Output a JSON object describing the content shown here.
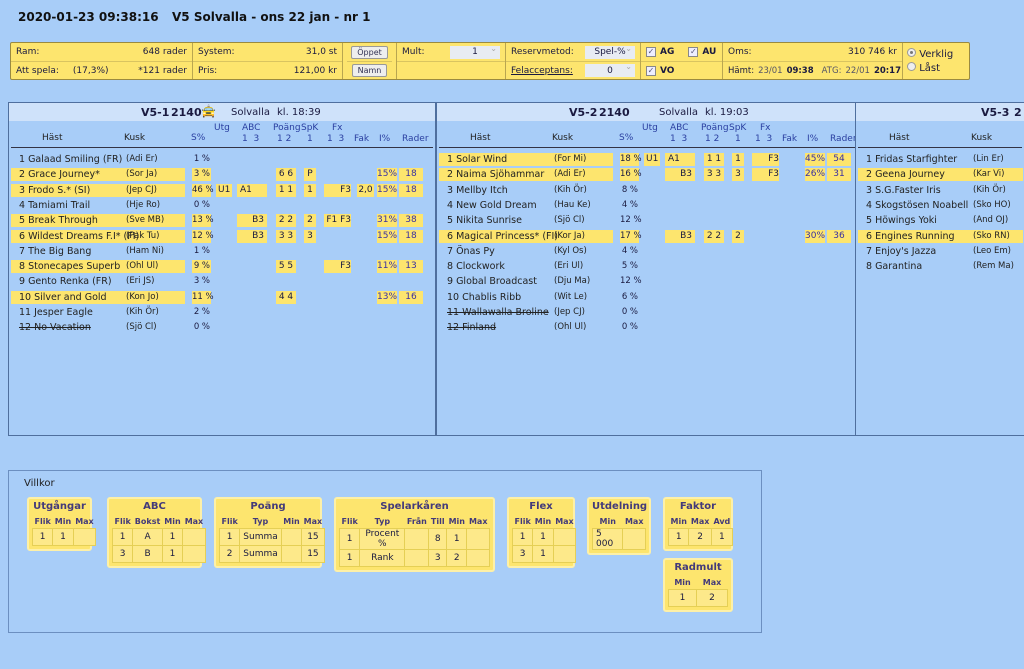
{
  "header": {
    "timestamp": "2020-01-23 09:38:16",
    "title": "V5 Solvalla - ons 22 jan - nr 1"
  },
  "topbar": {
    "ram_label": "Ram:",
    "ram_value": "648 rader",
    "att_spela_label": "Att spela:",
    "att_spela_pct": "(17,3%)",
    "att_spela_value": "*121 rader",
    "system_label": "System:",
    "system_value": "31,0 st",
    "pris_label": "Pris:",
    "pris_value": "121,00 kr",
    "oppet_button": "Öppet",
    "namn_button": "Namn",
    "mult_label": "Mult:",
    "mult_value": "1",
    "reservmetod_label": "Reservmetod:",
    "reservmetod_value": "Spel-%",
    "felacceptans_label": "Felacceptans:",
    "felacceptans_value": "0",
    "checkboxes": [
      {
        "label": "AG",
        "checked": true
      },
      {
        "label": "AU",
        "checked": true
      },
      {
        "label": "VO",
        "checked": true
      }
    ],
    "oms_label": "Oms:",
    "oms_value": "310 746 kr",
    "hamt_label": "Hämt:",
    "hamt_date": "23/01",
    "hamt_time": "09:38",
    "atg_label": "ATG:",
    "atg_date": "22/01",
    "atg_time": "20:17",
    "radios": [
      {
        "label": "Verklig",
        "selected": true
      },
      {
        "label": "Låst",
        "selected": false
      }
    ]
  },
  "columns": {
    "hast": "Häst",
    "kusk": "Kusk",
    "spct": "S%",
    "utg": "Utg",
    "abc": "ABC",
    "abc_sub": "1  3",
    "poang": "Poäng",
    "poang_sub": "1 2",
    "spk": "SpK",
    "spk_sub": "1",
    "fx": "Fx",
    "fx_sub": "1  3",
    "fak": "Fak",
    "ipct": "I%",
    "rader": "Rader"
  },
  "races": [
    {
      "id": "V5-1",
      "distance": "2140",
      "icon": "car-icon",
      "track": "Solvalla",
      "time": "kl. 18:39",
      "horses": [
        {
          "name": "1 Galaad Smiling (FR)",
          "kusk": "(Adi Er)",
          "spct": "1 %"
        },
        {
          "name": "2 Grace Journey*",
          "kusk": "(Sor Ja)",
          "spct": "3 %",
          "sel": true,
          "poang": "6 6",
          "spk": "P",
          "ipct": "15%",
          "rader": "18"
        },
        {
          "name": "3 Frodo S.* (SI)",
          "kusk": "(Jep CJ)",
          "spct": "46 %",
          "sel": true,
          "utg": "U1",
          "abc": "A1",
          "poang": "1 1",
          "spk": "1",
          "fx": "F3",
          "fak": "2,0",
          "ipct": "15%",
          "rader": "18"
        },
        {
          "name": "4 Tamiami Trail",
          "kusk": "(Hje Ro)",
          "spct": "0 %"
        },
        {
          "name": "5 Break Through",
          "kusk": "(Sve MB)",
          "spct": "13 %",
          "sel": true,
          "abc": "B3",
          "poang": "2 2",
          "spk": "2",
          "fx": "F1 F3",
          "ipct": "31%",
          "rader": "38"
        },
        {
          "name": "6 Wildest Dreams F.I* (FI)",
          "kusk": "(Pak Tu)",
          "spct": "12 %",
          "sel": true,
          "abc": "B3",
          "poang": "3 3",
          "spk": "3",
          "ipct": "15%",
          "rader": "18"
        },
        {
          "name": "7 The Big Bang",
          "kusk": "(Ham Ni)",
          "spct": "1 %"
        },
        {
          "name": "8 Stonecapes Superb",
          "kusk": "(Ohl Ul)",
          "spct": "9 %",
          "sel": true,
          "poang": "5 5",
          "fx": "F3",
          "ipct": "11%",
          "rader": "13"
        },
        {
          "name": "9 Gento Renka (FR)",
          "kusk": "(Eri JS)",
          "spct": "3 %"
        },
        {
          "name": "10 Silver and Gold",
          "kusk": "(Kon Jo)",
          "spct": "11 %",
          "sel": true,
          "poang": "4 4",
          "ipct": "13%",
          "rader": "16"
        },
        {
          "name": "11 Jesper Eagle",
          "kusk": "(Kih Ör)",
          "spct": "2 %"
        },
        {
          "name": "12 No Vacation",
          "kusk": "(Sjö Cl)",
          "spct": "0 %",
          "scratched": true
        }
      ]
    },
    {
      "id": "V5-2",
      "distance": "2140",
      "track": "Solvalla",
      "time": "kl. 19:03",
      "horses": [
        {
          "name": "1 Solar Wind",
          "kusk": "(For Mi)",
          "spct": "18 %",
          "sel": true,
          "utg": "U1",
          "abc": "A1",
          "poang": "1 1",
          "spk": "1",
          "fx": "F3",
          "ipct": "45%",
          "rader": "54"
        },
        {
          "name": "2 Naima Sjöhammar",
          "kusk": "(Adi Er)",
          "spct": "16 %",
          "sel": true,
          "abc": "B3",
          "poang": "3 3",
          "spk": "3",
          "fx": "F3",
          "ipct": "26%",
          "rader": "31"
        },
        {
          "name": "3 Mellby Itch",
          "kusk": "(Kih Ör)",
          "spct": "8 %"
        },
        {
          "name": "4 New Gold Dream",
          "kusk": "(Hau Ke)",
          "spct": "4 %"
        },
        {
          "name": "5 Nikita Sunrise",
          "kusk": "(Sjö Cl)",
          "spct": "12 %"
        },
        {
          "name": "6 Magical Princess* (FI)",
          "kusk": "(Kor Ja)",
          "spct": "17 %",
          "sel": true,
          "abc": "B3",
          "poang": "2 2",
          "spk": "2",
          "ipct": "30%",
          "rader": "36"
        },
        {
          "name": "7 Önas Py",
          "kusk": "(Kyl Os)",
          "spct": "4 %"
        },
        {
          "name": "8 Clockwork",
          "kusk": "(Eri Ul)",
          "spct": "5 %"
        },
        {
          "name": "9 Global Broadcast",
          "kusk": "(Dju Ma)",
          "spct": "12 %"
        },
        {
          "name": "10 Chablis Ribb",
          "kusk": "(Wit Le)",
          "spct": "6 %"
        },
        {
          "name": "11 Wallawalla Broline",
          "kusk": "(Jep CJ)",
          "spct": "0 %",
          "scratched": true
        },
        {
          "name": "12 Finland",
          "kusk": "(Ohl Ul)",
          "spct": "0 %",
          "scratched": true
        }
      ]
    },
    {
      "id": "V5-3",
      "distance": "2",
      "track": "",
      "time": "",
      "horses": [
        {
          "name": "1 Fridas Starfighter",
          "kusk": "(Lin Er)"
        },
        {
          "name": "2 Geena Journey",
          "kusk": "(Kar Vi)",
          "sel": true
        },
        {
          "name": "3 S.G.Faster Iris",
          "kusk": "(Kih Ör)"
        },
        {
          "name": "4 Skogstösen Noabell",
          "kusk": "(Sko HO)"
        },
        {
          "name": "5 Höwings Yoki",
          "kusk": "(And OJ)"
        },
        {
          "name": "6 Engines Running",
          "kusk": "(Sko RN)",
          "sel": true
        },
        {
          "name": "7 Enjoy's Jazza",
          "kusk": "(Leo Em)"
        },
        {
          "name": "8 Garantina",
          "kusk": "(Rem Ma)"
        }
      ]
    }
  ],
  "villkor": {
    "title": "Villkor",
    "cards": [
      {
        "title": "Utgångar",
        "headers": [
          "Flik",
          "Min",
          "Max"
        ],
        "rows": [
          [
            "1",
            "1",
            ""
          ]
        ]
      },
      {
        "title": "ABC",
        "headers": [
          "Flik",
          "Bokst",
          "Min",
          "Max"
        ],
        "rows": [
          [
            "1",
            "A",
            "1",
            ""
          ],
          [
            "3",
            "B",
            "1",
            ""
          ]
        ]
      },
      {
        "title": "Poäng",
        "headers": [
          "Flik",
          "Typ",
          "Min",
          "Max"
        ],
        "rows": [
          [
            "1",
            "Summa",
            "",
            "15"
          ],
          [
            "2",
            "Summa",
            "",
            "15"
          ]
        ]
      },
      {
        "title": "Spelarkåren",
        "headers": [
          "Flik",
          "Typ",
          "Från",
          "Till",
          "Min",
          "Max"
        ],
        "rows": [
          [
            "1",
            "Procent %",
            "",
            "8",
            "1",
            ""
          ],
          [
            "1",
            "Rank",
            "",
            "3",
            "2",
            ""
          ]
        ]
      },
      {
        "title": "Flex",
        "headers": [
          "Flik",
          "Min",
          "Max"
        ],
        "rows": [
          [
            "1",
            "1",
            ""
          ],
          [
            "3",
            "1",
            ""
          ]
        ]
      },
      {
        "title": "Utdelning",
        "headers": [
          "Min",
          "Max"
        ],
        "rows": [
          [
            "5 000",
            ""
          ]
        ]
      },
      {
        "title": "Faktor",
        "headers": [
          "Min",
          "Max",
          "Avd"
        ],
        "rows": [
          [
            "1",
            "2",
            "1"
          ]
        ]
      },
      {
        "title": "Radmult",
        "headers": [
          "Min",
          "Max"
        ],
        "rows": [
          [
            "1",
            "2"
          ]
        ]
      }
    ]
  }
}
